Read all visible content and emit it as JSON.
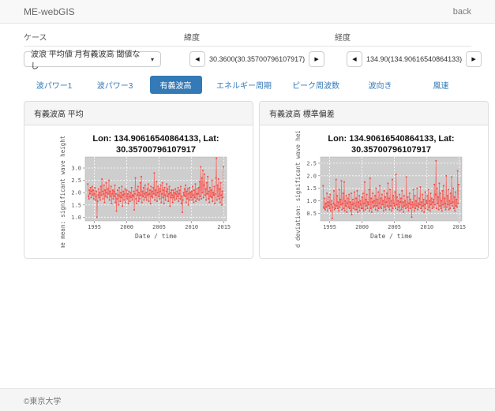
{
  "navbar": {
    "brand": "ME-webGIS",
    "back_label": "back"
  },
  "form": {
    "case": {
      "label": "ケース",
      "selected": "波浪 平均値 月有義波高 閾値なし",
      "caret_icon": "▾"
    },
    "latitude": {
      "label": "緯度",
      "value": "30.3600(30.35700796107917)",
      "prev_icon": "◀",
      "next_icon": "▶"
    },
    "longitude": {
      "label": "経度",
      "value": "134.90(134.90616540864133)",
      "prev_icon": "◀",
      "next_icon": "▶"
    }
  },
  "tabs": [
    {
      "label": "波パワー1",
      "active": false
    },
    {
      "label": "波パワー3",
      "active": false
    },
    {
      "label": "有義波高",
      "active": true
    },
    {
      "label": "エネルギー周期",
      "active": false
    },
    {
      "label": "ピーク周波数",
      "active": false
    },
    {
      "label": "波向き",
      "active": false
    },
    {
      "label": "風速",
      "active": false
    }
  ],
  "panels": [
    {
      "header": "有義波高 平均"
    },
    {
      "header": "有義波高 標準偏差"
    }
  ],
  "footer": {
    "copyright": "©東京大学"
  },
  "colors": {
    "accent": "#337ab7",
    "series_line": "#f4716c",
    "series_marker": "#ef4b46",
    "plot_bg": "#cecece",
    "panel_header_bg": "#f5f5f5"
  },
  "chart_data": [
    {
      "type": "line",
      "title_line1": "Lon: 134.90616540864133, Lat:",
      "title_line2": "30.35700796107917",
      "xlabel": "Date / time",
      "ylabel": "time mean: significant wave height (m)",
      "x_start": 1994.0,
      "x_step": 0.0833333,
      "xlim": [
        1993.6,
        2015.4
      ],
      "ylim": [
        0.85,
        3.45
      ],
      "xticks": [
        1995,
        2000,
        2005,
        2010,
        2015
      ],
      "yticks": [
        1.0,
        1.5,
        2.0,
        2.5,
        3.0
      ],
      "grid": true,
      "legend": "none",
      "values": [
        2.35,
        1.85,
        1.75,
        2.1,
        1.95,
        2.2,
        1.8,
        2.05,
        2.25,
        1.9,
        2.1,
        1.75,
        1.95,
        2.2,
        1.7,
        1.85,
        2.05,
        1.0,
        1.65,
        1.9,
        2.15,
        1.8,
        2.0,
        1.7,
        2.25,
        1.9,
        2.55,
        2.05,
        1.75,
        1.95,
        2.3,
        1.6,
        2.1,
        1.85,
        2.4,
        2.0,
        1.8,
        2.15,
        1.95,
        2.5,
        1.7,
        2.05,
        1.85,
        2.25,
        1.55,
        1.95,
        2.1,
        1.75,
        2.05,
        1.85,
        2.3,
        1.6,
        1.95,
        1.25,
        1.75,
        2.1,
        1.9,
        1.5,
        2.2,
        1.85,
        1.65,
        2.0,
        1.8,
        2.25,
        1.45,
        1.9,
        2.05,
        1.7,
        1.95,
        2.15,
        1.6,
        1.85,
        2.1,
        1.75,
        1.95,
        1.55,
        2.05,
        1.85,
        1.65,
        2.0,
        1.8,
        2.2,
        1.7,
        1.9,
        1.85,
        2.05,
        1.3,
        1.95,
        2.6,
        1.75,
        1.55,
        2.1,
        1.9,
        2.25,
        1.65,
        2.0,
        1.75,
        2.4,
        1.9,
        2.65,
        1.6,
        2.05,
        1.85,
        2.2,
        1.7,
        1.95,
        2.3,
        1.8,
        2.0,
        1.7,
        2.15,
        1.9,
        2.35,
        1.65,
        1.95,
        2.1,
        1.55,
        2.25,
        1.85,
        2.05,
        1.8,
        2.2,
        1.95,
        2.8,
        1.7,
        2.1,
        1.9,
        2.45,
        1.65,
        2.0,
        2.25,
        1.85,
        2.15,
        1.75,
        2.05,
        2.3,
        1.6,
        1.95,
        2.4,
        1.8,
        2.1,
        1.55,
        2.2,
        1.9,
        1.7,
        2.05,
        2.35,
        1.85,
        2.15,
        1.65,
        1.95,
        2.25,
        1.45,
        2.0,
        1.8,
        2.1,
        1.9,
        1.6,
        2.1,
        1.8,
        2.0,
        1.7,
        2.15,
        1.95,
        1.75,
        2.05,
        1.85,
        2.2,
        1.65,
        1.95,
        2.1,
        1.75,
        2.25,
        1.55,
        1.85,
        1.2,
        1.7,
        2.0,
        1.9,
        2.15,
        1.85,
        2.3,
        1.6,
        2.05,
        1.75,
        2.15,
        1.5,
        1.95,
        2.2,
        1.7,
        2.0,
        1.8,
        2.05,
        1.7,
        2.25,
        1.9,
        1.6,
        2.1,
        1.8,
        2.35,
        1.65,
        1.95,
        2.15,
        1.75,
        1.95,
        2.2,
        1.7,
        2.45,
        1.85,
        3.05,
        1.75,
        2.6,
        2.0,
        2.9,
        1.8,
        2.3,
        2.75,
        1.9,
        2.15,
        1.7,
        2.4,
        1.95,
        2.65,
        1.75,
        2.05,
        1.6,
        2.2,
        1.85,
        2.1,
        1.8,
        2.5,
        1.65,
        2.0,
        1.9,
        2.25,
        1.55,
        1.95,
        2.6,
        3.4,
        1.7,
        2.3,
        1.85,
        2.55,
        1.75,
        2.15,
        1.6,
        2.4,
        1.9,
        1.5,
        2.05,
        1.8,
        3.05
      ]
    },
    {
      "type": "line",
      "title_line1": "Lon: 134.90616540864133, Lat:",
      "title_line2": "30.35700796107917",
      "xlabel": "Date / time",
      "ylabel": "standard deviation: significant wave height (m)",
      "x_start": 1994.0,
      "x_step": 0.0833333,
      "xlim": [
        1993.6,
        2015.4
      ],
      "ylim": [
        0.2,
        2.75
      ],
      "xticks": [
        1995,
        2000,
        2005,
        2010,
        2015
      ],
      "yticks": [
        0.5,
        1.0,
        1.5,
        2.0,
        2.5
      ],
      "grid": true,
      "legend": "none",
      "values": [
        1.6,
        0.75,
        0.7,
        1.1,
        0.65,
        0.9,
        0.75,
        1.3,
        0.6,
        0.95,
        0.8,
        1.15,
        0.7,
        1.25,
        0.6,
        0.85,
        1.0,
        0.3,
        0.75,
        0.9,
        1.4,
        0.65,
        0.85,
        0.7,
        1.85,
        0.8,
        1.2,
        0.7,
        0.95,
        0.6,
        1.45,
        0.75,
        1.05,
        0.85,
        1.8,
        0.65,
        0.9,
        1.3,
        0.7,
        1.75,
        0.6,
        1.0,
        0.8,
        1.2,
        0.55,
        0.9,
        1.1,
        0.75,
        1.25,
        0.7,
        0.95,
        0.6,
        1.3,
        0.45,
        0.85,
        1.05,
        0.7,
        0.9,
        1.35,
        0.65,
        0.8,
        1.1,
        0.65,
        1.4,
        0.55,
        0.95,
        0.75,
        1.2,
        0.6,
        1.0,
        0.85,
        0.7,
        1.15,
        0.7,
        1.3,
        0.6,
        0.9,
        1.75,
        0.65,
        1.05,
        0.8,
        1.25,
        0.7,
        0.95,
        0.85,
        1.45,
        0.6,
        1.9,
        0.7,
        1.1,
        0.55,
        0.95,
        1.3,
        0.75,
        1.0,
        0.8,
        1.2,
        0.65,
        1.5,
        0.8,
        1.05,
        0.6,
        1.35,
        0.7,
        0.9,
        1.6,
        0.75,
        1.1,
        0.7,
        1.25,
        0.85,
        1.0,
        0.6,
        1.4,
        0.75,
        1.15,
        0.65,
        0.95,
        1.3,
        0.8,
        1.7,
        0.75,
        1.1,
        0.65,
        1.45,
        0.8,
        1.0,
        0.6,
        1.85,
        0.7,
        1.2,
        0.9,
        0.8,
        1.35,
        0.7,
        2.05,
        0.85,
        1.15,
        0.65,
        1.0,
        0.75,
        1.25,
        0.6,
        0.95,
        1.1,
        0.65,
        1.4,
        0.75,
        0.95,
        0.55,
        1.2,
        0.8,
        1.0,
        0.7,
        1.95,
        0.85,
        0.75,
        1.15,
        0.6,
        0.9,
        1.3,
        0.7,
        1.05,
        0.85,
        0.35,
        0.95,
        0.75,
        1.45,
        0.85,
        0.6,
        1.2,
        0.7,
        1.0,
        0.8,
        1.5,
        0.65,
        0.9,
        0.75,
        1.1,
        0.85,
        1.55,
        0.7,
        0.95,
        0.6,
        1.25,
        0.8,
        1.05,
        0.55,
        0.85,
        1.35,
        0.7,
        1.0,
        0.9,
        1.2,
        0.65,
        1.45,
        0.75,
        1.0,
        0.6,
        1.3,
        0.85,
        1.1,
        0.7,
        0.95,
        1.05,
        0.75,
        1.65,
        0.85,
        1.25,
        2.6,
        0.7,
        1.5,
        0.9,
        1.15,
        0.65,
        1.7,
        0.8,
        1.3,
        0.7,
        1.0,
        0.6,
        1.4,
        0.85,
        1.6,
        0.75,
        1.1,
        0.9,
        0.65,
        2.0,
        0.75,
        1.2,
        0.85,
        1.45,
        0.65,
        1.0,
        0.7,
        1.3,
        0.9,
        1.95,
        0.8,
        0.95,
        1.5,
        0.7,
        1.15,
        0.6,
        1.35,
        0.8,
        1.05,
        0.75,
        2.2,
        0.9,
        1.65
      ]
    }
  ]
}
